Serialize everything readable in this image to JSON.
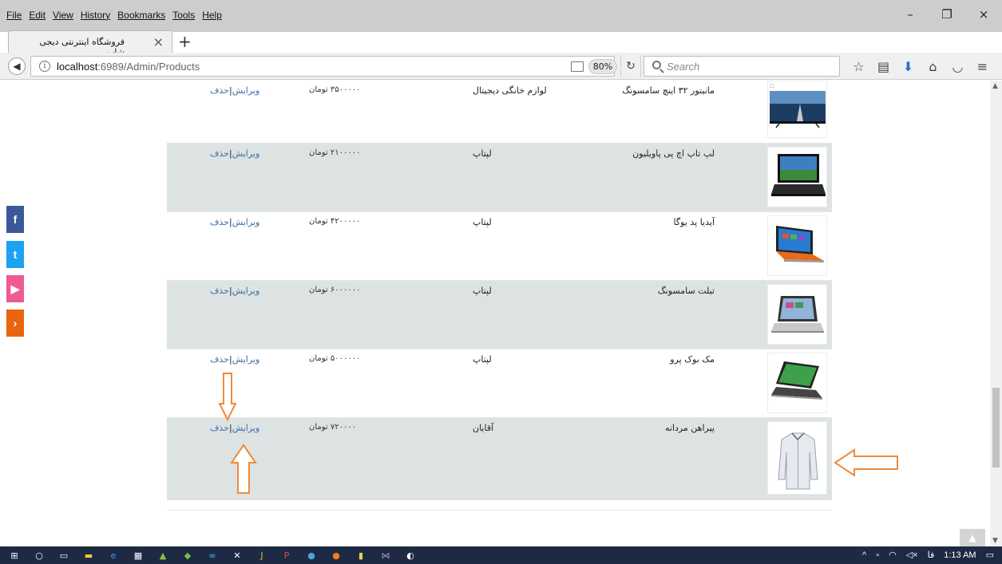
{
  "menu": [
    "File",
    "Edit",
    "View",
    "History",
    "Bookmarks",
    "Tools",
    "Help"
  ],
  "window_controls": {
    "minimize": "–",
    "restore": "❐",
    "close": "×"
  },
  "tab": {
    "title": "فروشگاه اینترنتی دیجی شاپ",
    "close": "×",
    "new_tab": "+"
  },
  "address": {
    "host": "localhost",
    "rest": ":6989/Admin/Products"
  },
  "zoom": "80%",
  "search": {
    "placeholder": "Search"
  },
  "products": [
    {
      "name": "مانیتور ۳۲ اینچ سامسونگ",
      "category": "لوازم خانگی دیجیتال",
      "price": "۳۵۰۰۰۰۰ تومان",
      "edit": "ویرایش",
      "delete": "حذف",
      "sep": "|"
    },
    {
      "name": "لپ تاپ اچ پی پاویلیون",
      "category": "لپتاپ",
      "price": "۲۱۰۰۰۰۰ تومان",
      "edit": "ویرایش",
      "delete": "حذف",
      "sep": "|"
    },
    {
      "name": "آیدیا پد یوگا",
      "category": "لپتاپ",
      "price": "۴۲۰۰۰۰۰ تومان",
      "edit": "ویرایش",
      "delete": "حذف",
      "sep": "|"
    },
    {
      "name": "تبلت سامسونگ",
      "category": "لپتاپ",
      "price": "۶۰۰۰۰۰۰ تومان",
      "edit": "ویرایش",
      "delete": "حذف",
      "sep": "|"
    },
    {
      "name": "مک بوک پرو",
      "category": "لپتاپ",
      "price": "۵۰۰۰۰۰۰ تومان",
      "edit": "ویرایش",
      "delete": "حذف",
      "sep": "|"
    },
    {
      "name": "پیراهن مردانه",
      "category": "آقایان",
      "price": "۷۲۰۰۰۰ تومان",
      "edit": "ویرایش",
      "delete": "حذف",
      "sep": "|"
    }
  ],
  "social": {
    "facebook": "f",
    "twitter": "t",
    "youtube": "▶",
    "more": "›"
  },
  "taskbar": {
    "lang": "فا",
    "time": "1:13 AM"
  },
  "colors": {
    "row_shade": "#dde3e3",
    "link": "#3a6fa8",
    "annotation": "#f08a3a"
  }
}
